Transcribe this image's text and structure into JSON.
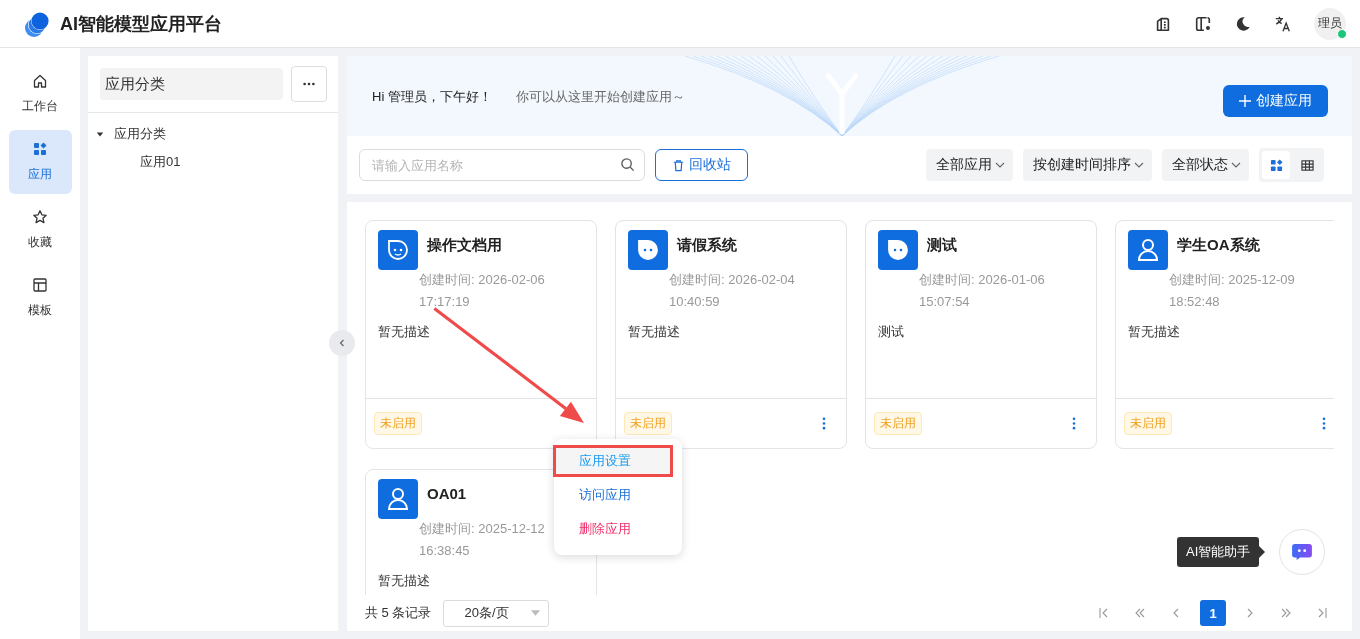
{
  "header": {
    "title": "AI智能模型应用平台",
    "avatar": "理员",
    "online": true
  },
  "nav": [
    {
      "label": "工作台",
      "kind": "home",
      "selected": false
    },
    {
      "label": "应用",
      "kind": "apps",
      "selected": true
    },
    {
      "label": "收藏",
      "kind": "star",
      "selected": false
    },
    {
      "label": "模板",
      "kind": "layout",
      "selected": false
    }
  ],
  "category_panel": {
    "title": "应用分类",
    "tree": [
      {
        "label": "应用分类",
        "expanded": true,
        "children": [
          {
            "label": "应用01"
          }
        ]
      }
    ]
  },
  "banner": {
    "greeting": "Hi 管理员，下午好！",
    "hint": "你可以从这里开始创建应用～",
    "create_button": "创建应用"
  },
  "toolbar": {
    "search_placeholder": "请输入应用名称",
    "recycle_button": "回收站",
    "filters": [
      "全部应用",
      "按创建时间排序",
      "全部状态"
    ],
    "views": [
      {
        "kind": "card",
        "selected": true
      },
      {
        "kind": "table",
        "selected": false
      }
    ]
  },
  "apps": [
    {
      "name": "操作文档用",
      "kind": "bot",
      "created": "创建时间: 2026-02-06 17:17:19",
      "description": "暂无描述",
      "status": "未启用",
      "more_button": false
    },
    {
      "name": "请假系统",
      "kind": "bot",
      "created": "创建时间: 2026-02-04 10:40:59",
      "description": "暂无描述",
      "status": "未启用",
      "more_button": true
    },
    {
      "name": "测试",
      "kind": "bot",
      "created": "创建时间: 2026-01-06 15:07:54",
      "description": "测试",
      "status": "未启用",
      "more_button": true
    },
    {
      "name": "学生OA系统",
      "kind": "user",
      "created": "创建时间: 2025-12-09 18:52:48",
      "description": "暂无描述",
      "status": "未启用",
      "more_button": true
    },
    {
      "name": "OA01",
      "kind": "user",
      "created": "创建时间: 2025-12-12 16:38:45",
      "description": "暂无描述"
    }
  ],
  "context_menu": [
    {
      "label": "应用设置",
      "kind": "primary",
      "hovered": true,
      "annotated": true
    },
    {
      "label": "访问应用",
      "kind": "link",
      "hovered": false,
      "annotated": false
    },
    {
      "label": "删除应用",
      "kind": "danger",
      "hovered": false,
      "annotated": false
    }
  ],
  "annotation_arrow": true,
  "pagination": {
    "total": "共 5 条记录",
    "page_size": "20条/页",
    "pages": [
      {
        "label": "1",
        "selected": true
      }
    ]
  },
  "assistant": {
    "tooltip": "AI智能助手"
  }
}
